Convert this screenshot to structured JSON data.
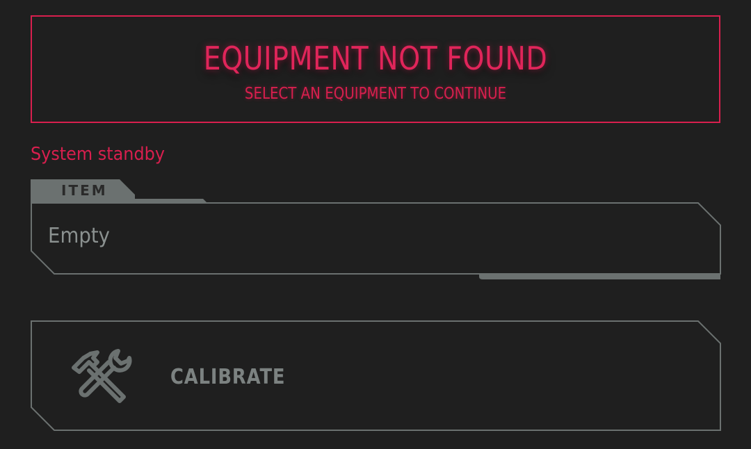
{
  "alert": {
    "title": "EQUIPMENT NOT FOUND",
    "subtitle": "SELECT AN EQUIPMENT TO CONTINUE",
    "color": "#d81f4e"
  },
  "status": {
    "text": "System standby"
  },
  "item_field": {
    "tab_label": "ITEM",
    "value": "Empty"
  },
  "calibrate": {
    "label": "CALIBRATE",
    "icon": "hammer-wrench-icon"
  },
  "colors": {
    "background": "#1f1f1f",
    "accent": "#d81f4e",
    "frame": "#6b7170",
    "muted_text": "#8b9190"
  }
}
